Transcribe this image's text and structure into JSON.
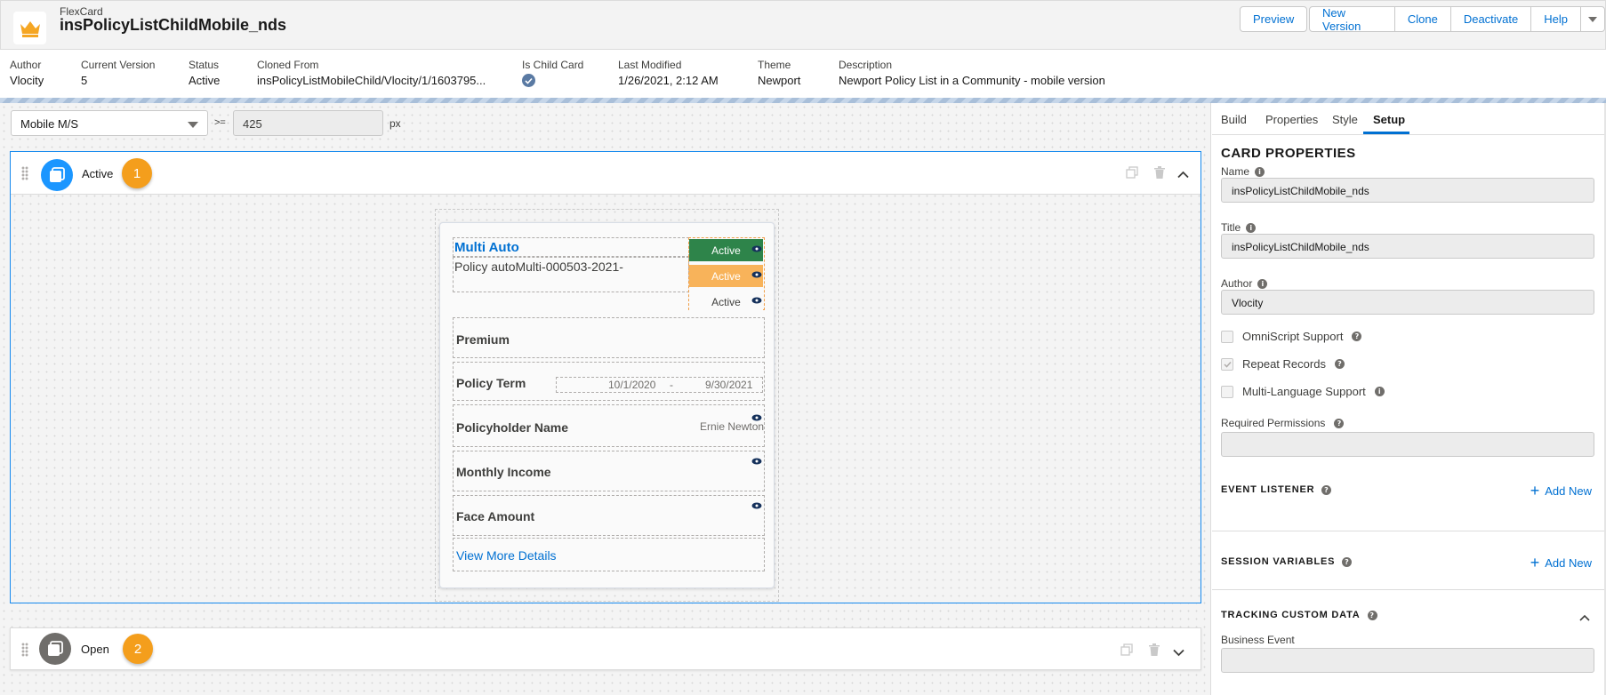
{
  "header": {
    "type_label": "FlexCard",
    "title": "insPolicyListChildMobile_nds",
    "buttons": {
      "preview": "Preview",
      "new_version": "New Version",
      "clone": "Clone",
      "deactivate": "Deactivate",
      "help": "Help"
    }
  },
  "meta": {
    "author": {
      "label": "Author",
      "value": "Vlocity"
    },
    "current_version": {
      "label": "Current Version",
      "value": "5"
    },
    "status": {
      "label": "Status",
      "value": "Active"
    },
    "cloned_from": {
      "label": "Cloned From",
      "value": "insPolicyListMobileChild/Vlocity/1/1603795..."
    },
    "is_child_card": {
      "label": "Is Child Card",
      "icon": "check-circle-icon"
    },
    "last_modified": {
      "label": "Last Modified",
      "value": "1/26/2021, 2:12 AM"
    },
    "theme": {
      "label": "Theme",
      "value": "Newport"
    },
    "description": {
      "label": "Description",
      "value": "Newport Policy List in a Community - mobile version"
    }
  },
  "toolbar": {
    "device": "Mobile M/S",
    "operator": ">=",
    "breakpoint": "425",
    "unit": "px"
  },
  "states": [
    {
      "name": "Active",
      "number": "1",
      "icon_color": "#1b96ff"
    },
    {
      "name": "Open",
      "number": "2",
      "icon_color": "#706e6b"
    }
  ],
  "card": {
    "title": "Multi Auto",
    "policy_line": "Policy autoMulti-000503-2021-",
    "status_chips": [
      {
        "label": "Active",
        "bg": "#2e844a",
        "fg": "#ffffff"
      },
      {
        "label": "Active",
        "bg": "#f8b35a",
        "fg": "#ffffff"
      },
      {
        "label": "Active",
        "bg": "#fafafa",
        "fg": "#3e3e3c"
      }
    ],
    "rows": {
      "premium": "Premium",
      "policy_term": "Policy Term",
      "term_start": "10/1/2020",
      "term_sep": "-",
      "term_end": "9/30/2021",
      "policyholder": "Policyholder Name",
      "policyholder_value": "Ernie Newton",
      "monthly_income": "Monthly Income",
      "face_amount": "Face Amount"
    },
    "more_link": "View More Details"
  },
  "right_panel": {
    "tabs": [
      "Build",
      "Properties",
      "Style",
      "Setup"
    ],
    "active_tab": "Setup",
    "card_properties": {
      "title": "CARD PROPERTIES",
      "name_label": "Name",
      "name_value": "insPolicyListChildMobile_nds",
      "title_label": "Title",
      "title_value": "insPolicyListChildMobile_nds",
      "author_label": "Author",
      "author_value": "Vlocity",
      "omniscript": "OmniScript Support",
      "repeat_records": "Repeat Records",
      "multi_language": "Multi-Language Support",
      "required_permissions": "Required Permissions"
    },
    "event_listener": {
      "title": "EVENT LISTENER",
      "add": "Add New"
    },
    "session_variables": {
      "title": "SESSION VARIABLES",
      "add": "Add New"
    },
    "tracking": {
      "title": "TRACKING CUSTOM DATA",
      "business_event": "Business Event"
    }
  }
}
